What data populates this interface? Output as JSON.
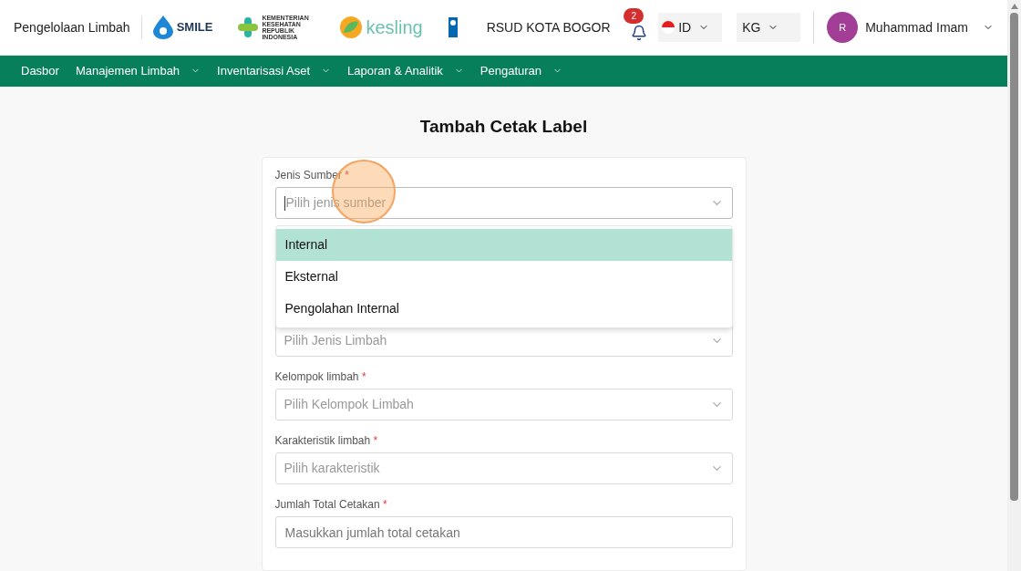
{
  "header": {
    "app_title": "Pengelolaan Limbah",
    "logos": [
      {
        "kind": "smile",
        "text": "SMILE"
      },
      {
        "kind": "kemenkes",
        "text": "KEMENTERIAN KESEHATAN REPUBLIK INDONESIA"
      },
      {
        "kind": "kesling",
        "text": "kesling"
      },
      {
        "kind": "undp"
      }
    ],
    "hospital": "RSUD KOTA BOGOR",
    "notifications": "2",
    "language": "ID",
    "unit": "KG",
    "user": {
      "initial": "R",
      "name": "Muhammad Imam"
    }
  },
  "nav": [
    {
      "label": "Dasbor",
      "has_menu": false
    },
    {
      "label": "Manajemen Limbah",
      "has_menu": true
    },
    {
      "label": "Inventarisasi Aset",
      "has_menu": true
    },
    {
      "label": "Laporan & Analitik",
      "has_menu": true
    },
    {
      "label": "Pengaturan",
      "has_menu": true
    }
  ],
  "page_title": "Tambah Cetak Label",
  "fields": [
    {
      "kind": "select",
      "label": "Jenis Sumber",
      "required_mark": "*",
      "placeholder": "Pilih jenis sumber",
      "expanded": true,
      "options": [
        {
          "label": "Internal",
          "selected": true
        },
        {
          "label": "Eksternal",
          "selected": false
        },
        {
          "label": "Pengolahan Internal",
          "selected": false
        }
      ]
    },
    {
      "kind": "select",
      "placeholder": "Pilih Jenis Limbah",
      "expanded": false
    },
    {
      "kind": "select",
      "label": "Kelompok limbah",
      "required_mark": "*",
      "placeholder": "Pilih Kelompok Limbah",
      "expanded": false
    },
    {
      "kind": "select",
      "label": "Karakteristik limbah",
      "required_mark": "*",
      "placeholder": "Pilih karakteristik",
      "expanded": false
    },
    {
      "kind": "input",
      "label": "Jumlah Total Cetakan",
      "required_mark": "*",
      "placeholder": "Masukkan jumlah total cetakan"
    }
  ]
}
